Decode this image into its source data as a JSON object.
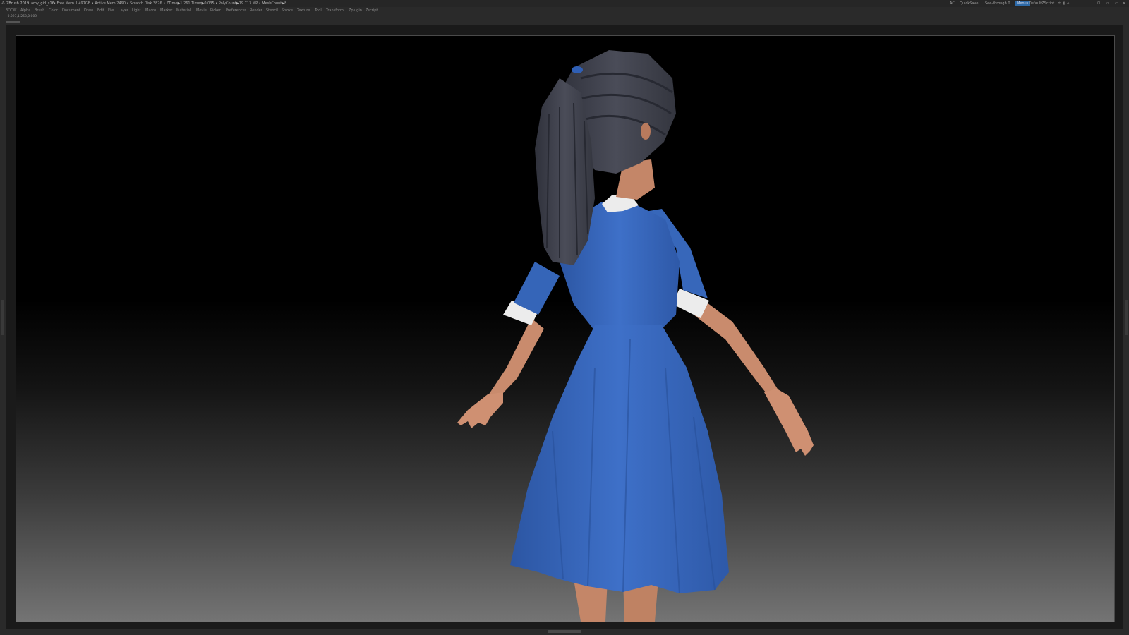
{
  "title_bar": {
    "app_name": "ZBrush 2019",
    "file_name": "amy_girl_s16",
    "stats": "• Free Mem 1.497GB • Active Mem 2490 • Scratch Disk 3826 • ZTime▶1.261 Timer▶0.035 • PolyCount▶19.713 MP • MeshCount▶8"
  },
  "right_controls": {
    "ac": "AC",
    "quicksave": "QuickSave",
    "see_through": "See-through  0",
    "menus": "Menus",
    "script": "DefaultZScript"
  },
  "menu": [
    "3DCW",
    "Alpha",
    "Brush",
    "Color",
    "Document",
    "Draw",
    "Edit",
    "File",
    "Layer",
    "Light",
    "Macro",
    "Marker",
    "Material",
    "Movie",
    "Picker",
    "Preferences",
    "Render",
    "Stencil",
    "Stroke",
    "Texture",
    "Tool",
    "Transform",
    "Zplugin",
    "Zscript"
  ],
  "coordinates": "-0.097,1.263,0.009",
  "colors": {
    "dress": "#3a6ac0",
    "hair": "#3d3f4b",
    "skin": "#c88a6c",
    "collar": "#ececec",
    "accent": "#2d6aa8"
  },
  "icons": [
    "minimize-icon",
    "restore-icon",
    "close-icon",
    "layout-icon"
  ]
}
